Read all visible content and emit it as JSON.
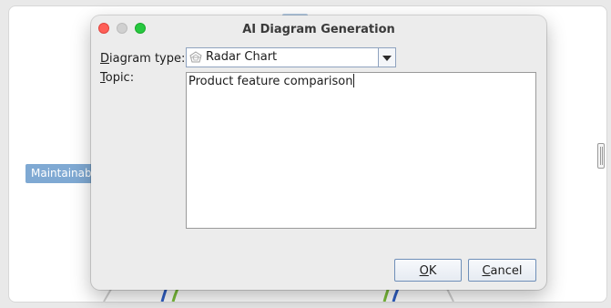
{
  "background": {
    "node_label": "Maintainabil",
    "colors": {
      "node": "#7fa9d3",
      "series_blue": "#2f5fc4",
      "series_green": "#7bbf3a"
    }
  },
  "dialog": {
    "title": "AI Diagram Generation",
    "diagram_type_label": {
      "mnemonic": "D",
      "rest": "iagram type:"
    },
    "diagram_type_value": "Radar Chart",
    "diagram_type_icon": "radar-chart-icon",
    "topic_label": {
      "mnemonic": "T",
      "rest": "opic:"
    },
    "topic_value": "Product feature comparison",
    "ok_button": {
      "mnemonic": "O",
      "rest": "K"
    },
    "cancel_button": {
      "mnemonic": "C",
      "rest": "ancel"
    },
    "window_controls": [
      "close",
      "minimize",
      "zoom"
    ]
  }
}
